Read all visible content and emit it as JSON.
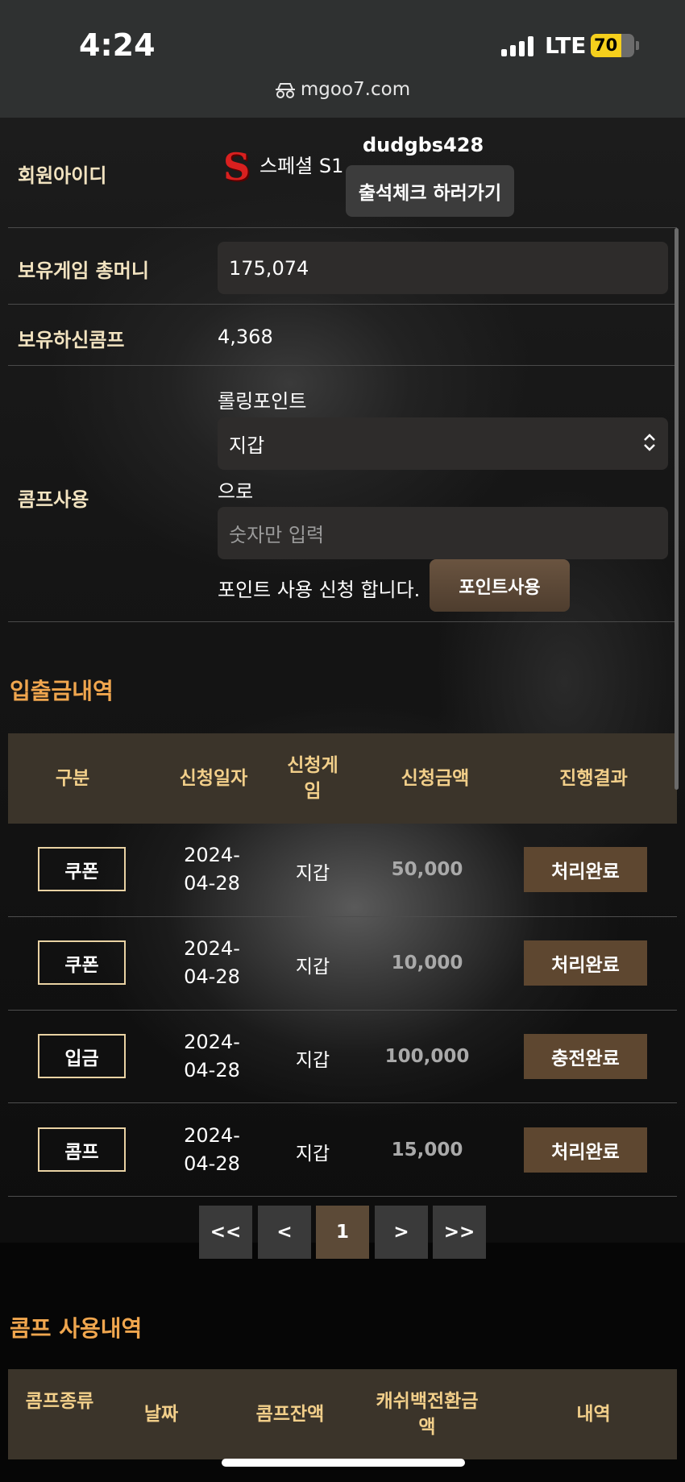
{
  "status_bar": {
    "time": "4:24",
    "network": "LTE",
    "battery": "70"
  },
  "url_bar": {
    "domain": "mgoo7.com"
  },
  "member": {
    "label": "회원아이디",
    "level": "스페셜 S1",
    "logo_letter": "S",
    "username": "dudgbs428",
    "attendance_button": "출석체크 하러가기"
  },
  "money": {
    "label": "보유게임 총머니",
    "value": "175,074"
  },
  "comp": {
    "label": "보유하신콤프",
    "value": "4,368"
  },
  "comp_use": {
    "label": "콤프사용",
    "rolling_label": "롤링포인트",
    "select_value": "지갑",
    "to_label": "으로",
    "amount_placeholder": "숫자만 입력",
    "apply_text": "포인트 사용 신청 합니다.",
    "apply_button": "포인트사용"
  },
  "history": {
    "title": "입출금내역",
    "columns": {
      "type": "구분",
      "date": "신청일자",
      "game": "신청게임",
      "amount": "신청금액",
      "result": "진행결과"
    },
    "rows": [
      {
        "type": "쿠폰",
        "date_y": "2024-",
        "date_md": "04-28",
        "game": "지갑",
        "amount": "50,000",
        "result": "처리완료"
      },
      {
        "type": "쿠폰",
        "date_y": "2024-",
        "date_md": "04-28",
        "game": "지갑",
        "amount": "10,000",
        "result": "처리완료"
      },
      {
        "type": "입금",
        "date_y": "2024-",
        "date_md": "04-28",
        "game": "지갑",
        "amount": "100,000",
        "result": "충전완료"
      },
      {
        "type": "콤프",
        "date_y": "2024-",
        "date_md": "04-28",
        "game": "지갑",
        "amount": "15,000",
        "result": "처리완료"
      }
    ]
  },
  "pagination": {
    "first": "<<",
    "prev": "<",
    "current": "1",
    "next": ">",
    "last": ">>"
  },
  "comp_history": {
    "title": "콤프 사용내역",
    "columns": {
      "kind": "콤프종류",
      "date": "날짜",
      "balance": "콤프잔액",
      "cashback": "캐쉬백전환금액",
      "detail": "내역"
    }
  }
}
